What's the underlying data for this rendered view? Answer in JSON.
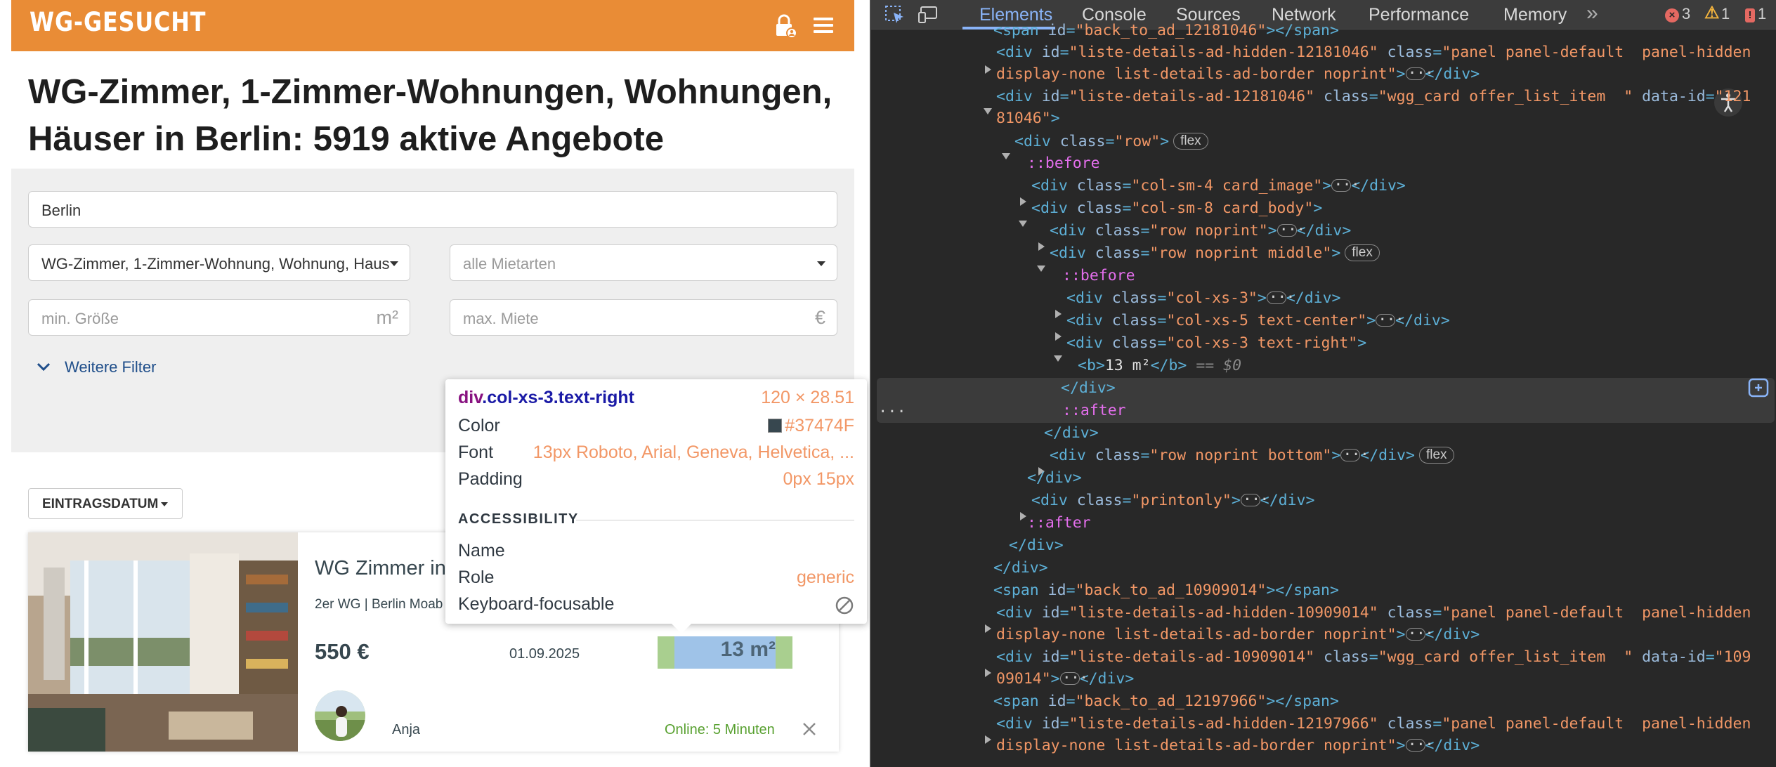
{
  "webpage": {
    "logo": "WG-GESUCHT",
    "title": "WG-Zimmer, 1-Zimmer-Wohnungen, Wohnungen, Häuser in Berlin: 5919 aktive Angebote",
    "search": {
      "city": "Berlin",
      "category": "WG-Zimmer, 1-Zimmer-Wohnung, Wohnung, Haus",
      "rent_type_placeholder": "alle Mietarten",
      "min_size_placeholder": "min. Größe",
      "min_size_unit": "m²",
      "max_rent_placeholder": "max. Miete",
      "max_rent_unit": "€",
      "more_filters": "Weitere Filter"
    },
    "sort_label": "EINTRAGSDATUM",
    "listing": {
      "title": "WG Zimmer in",
      "subtitle": "2er WG | Berlin Moab",
      "price": "550 €",
      "date": "01.09.2025",
      "size": "13 m²",
      "user": "Anja",
      "online": "Online: 5 Minuten"
    },
    "inspector_tooltip": {
      "element_tag": "div",
      "element_class": ".col-xs-3.text-right",
      "dimensions": "120 × 28.51",
      "color_label": "Color",
      "color_value": "#37474F",
      "font_label": "Font",
      "font_value": "13px Roboto, Arial, Geneva, Helvetica, ...",
      "padding_label": "Padding",
      "padding_value": "0px 15px",
      "accessibility_heading": "ACCESSIBILITY",
      "name_label": "Name",
      "role_label": "Role",
      "role_value": "generic",
      "focusable_label": "Keyboard-focusable"
    }
  },
  "devtools": {
    "tabs": [
      "Elements",
      "Console",
      "Sources",
      "Network",
      "Performance",
      "Memory"
    ],
    "active_tab": "Elements",
    "errors": "3",
    "warnings": "1",
    "issues": "1",
    "selected_suffix": "== $0",
    "colors": {
      "tag": "#5db0d7",
      "attr": "#9bbbdc",
      "value": "#f29766",
      "pseudo": "#e36eec",
      "accent": "#8ab4f8"
    }
  }
}
